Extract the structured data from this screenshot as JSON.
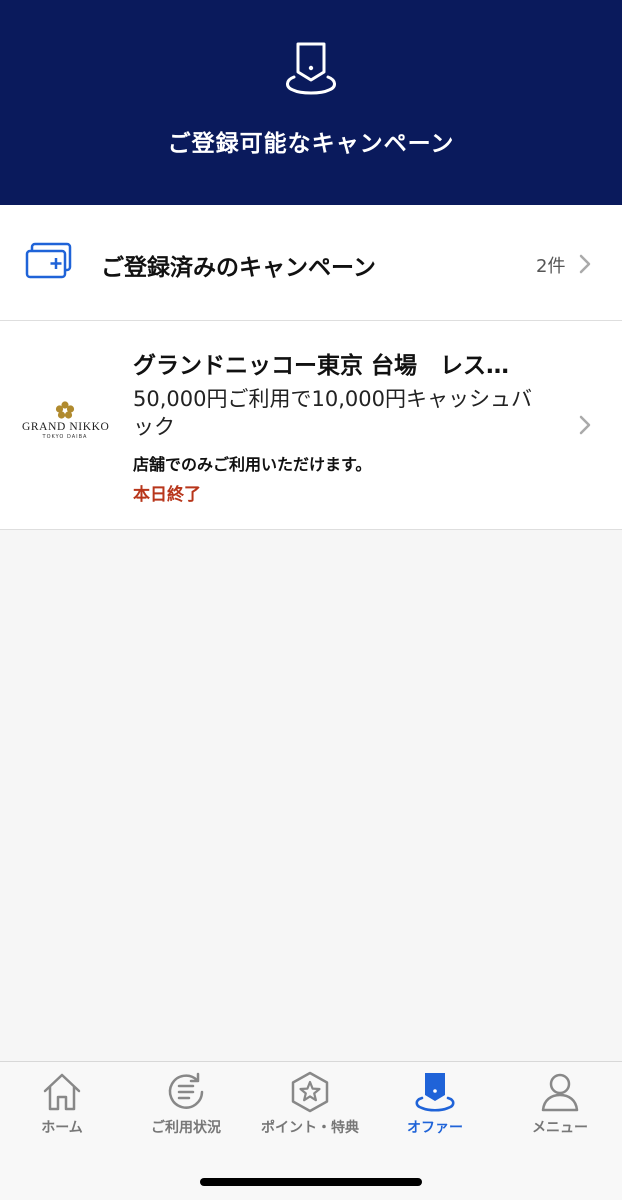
{
  "header": {
    "title": "ご登録可能なキャンペーン",
    "icon": "offer-tag-icon",
    "background_color": "#0a1a5c"
  },
  "registered": {
    "label": "ご登録済みのキャンペーン",
    "count": "2件",
    "icon": "registered-cards-icon"
  },
  "campaigns": [
    {
      "logo_name": "GRAND NIKKO",
      "logo_sub": "TOKYO DAIBA",
      "title": "グランドニッコー東京 台場　レス…",
      "description": "50,000円ご利用で10,000円キャッシュバック",
      "note": "店舗でのみご利用いただけます。",
      "end_label": "本日終了",
      "end_color": "#b8361b"
    }
  ],
  "tabs": [
    {
      "label": "ホーム",
      "icon": "home-icon",
      "active": false
    },
    {
      "label": "ご利用状況",
      "icon": "usage-list-icon",
      "active": false
    },
    {
      "label": "ポイント・特典",
      "icon": "points-star-icon",
      "active": false
    },
    {
      "label": "オファー",
      "icon": "offer-icon",
      "active": true
    },
    {
      "label": "メニュー",
      "icon": "user-menu-icon",
      "active": false
    }
  ],
  "accent_color": "#1f63d8"
}
